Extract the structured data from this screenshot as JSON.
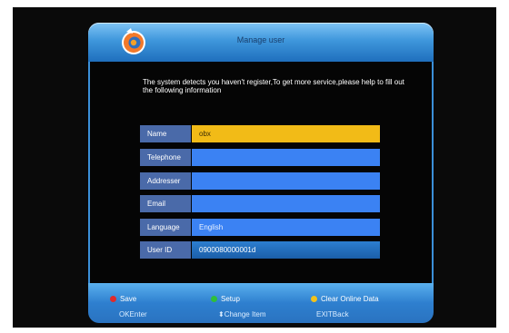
{
  "header": {
    "title": "Manage user"
  },
  "message": "The system detects you haven't register,To get more service,please help to fill out the following information",
  "form": {
    "rows": [
      {
        "label": "Name",
        "value": "obx",
        "state": "selected"
      },
      {
        "label": "Telephone",
        "value": "",
        "state": "normal"
      },
      {
        "label": "Addresser",
        "value": "",
        "state": "normal"
      },
      {
        "label": "Email",
        "value": "",
        "state": "normal"
      },
      {
        "label": "Language",
        "value": "English",
        "state": "normal"
      },
      {
        "label": "User ID",
        "value": "0900080000001d",
        "state": "readonly"
      }
    ]
  },
  "footer": {
    "keys": [
      {
        "label": "Save",
        "color": "#e02a2a"
      },
      {
        "label": "Setup",
        "color": "#2fbf3a"
      },
      {
        "label": "Clear Online Data",
        "color": "#f2c21a"
      }
    ],
    "hints": {
      "ok": "OKEnter",
      "change": "Change Item",
      "exit": "EXITBack"
    }
  },
  "colors": {
    "accent": "#3b82f3",
    "selected": "#f2bb17",
    "label_bg": "#4a6aa9"
  }
}
